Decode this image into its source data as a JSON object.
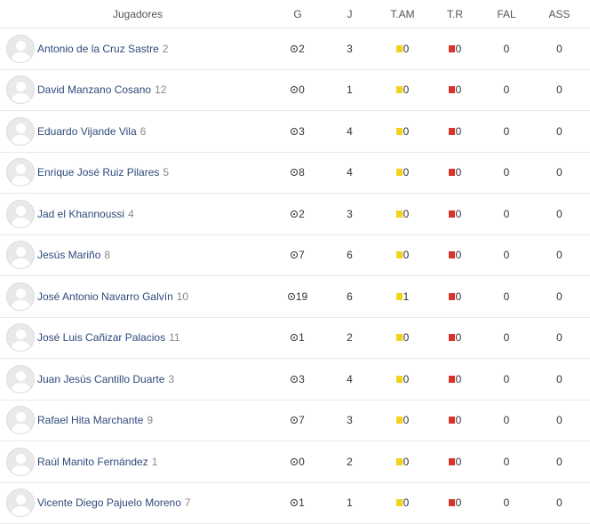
{
  "header": {
    "jugadores": "Jugadores",
    "g": "G",
    "j": "J",
    "tam": "T.AM",
    "tr": "T.R",
    "fal": "FAL",
    "ass": "ASS"
  },
  "icons": {
    "goal": "soccer-ball-icon",
    "yellow_card": "yellow-card-icon",
    "red_card": "red-card-icon",
    "avatar": "avatar-placeholder-icon"
  },
  "colors": {
    "player_name": "#2f4a7a",
    "yellow_card": "#f2d31b",
    "red_card": "#d9342b"
  },
  "players": [
    {
      "name": "Antonio de la Cruz Sastre",
      "number": "2",
      "g": "2",
      "j": "3",
      "tam": "0",
      "tr": "0",
      "fal": "0",
      "ass": "0"
    },
    {
      "name": "David Manzano Cosano",
      "number": "12",
      "g": "0",
      "j": "1",
      "tam": "0",
      "tr": "0",
      "fal": "0",
      "ass": "0"
    },
    {
      "name": "Eduardo Vijande Vila",
      "number": "6",
      "g": "3",
      "j": "4",
      "tam": "0",
      "tr": "0",
      "fal": "0",
      "ass": "0"
    },
    {
      "name": "Enrique José Ruiz Pilares",
      "number": "5",
      "g": "8",
      "j": "4",
      "tam": "0",
      "tr": "0",
      "fal": "0",
      "ass": "0"
    },
    {
      "name": "Jad el Khannoussi",
      "number": "4",
      "g": "2",
      "j": "3",
      "tam": "0",
      "tr": "0",
      "fal": "0",
      "ass": "0"
    },
    {
      "name": "Jesús Mariño",
      "number": "8",
      "g": "7",
      "j": "6",
      "tam": "0",
      "tr": "0",
      "fal": "0",
      "ass": "0"
    },
    {
      "name": "José Antonio Navarro Galvín",
      "number": "10",
      "g": "19",
      "j": "6",
      "tam": "1",
      "tr": "0",
      "fal": "0",
      "ass": "0"
    },
    {
      "name": "José Luis Cañizar Palacios",
      "number": "11",
      "g": "1",
      "j": "2",
      "tam": "0",
      "tr": "0",
      "fal": "0",
      "ass": "0"
    },
    {
      "name": "Juan Jesús Cantillo Duarte",
      "number": "3",
      "g": "3",
      "j": "4",
      "tam": "0",
      "tr": "0",
      "fal": "0",
      "ass": "0"
    },
    {
      "name": "Rafael Hita Marchante",
      "number": "9",
      "g": "7",
      "j": "3",
      "tam": "0",
      "tr": "0",
      "fal": "0",
      "ass": "0"
    },
    {
      "name": "Raúl Manito Fernández",
      "number": "1",
      "g": "0",
      "j": "2",
      "tam": "0",
      "tr": "0",
      "fal": "0",
      "ass": "0"
    },
    {
      "name": "Vicente Diego Pajuelo Moreno",
      "number": "7",
      "g": "1",
      "j": "1",
      "tam": "0",
      "tr": "0",
      "fal": "0",
      "ass": "0"
    }
  ]
}
